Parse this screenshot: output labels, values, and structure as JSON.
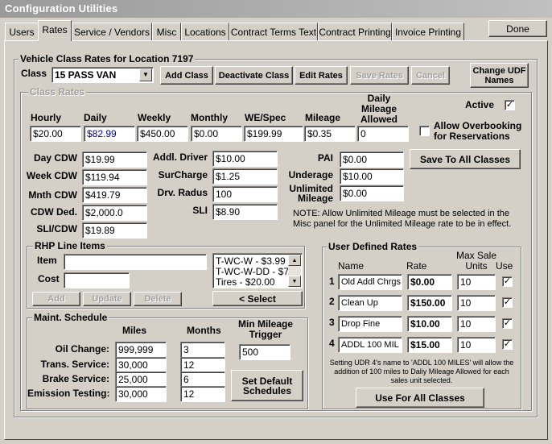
{
  "window": {
    "title": "Configuration Utilities"
  },
  "tabs": [
    "Users",
    "Rates",
    "Service / Vendors",
    "Misc",
    "Locations",
    "Contract Terms Text",
    "Contract Printing",
    "Invoice  Printing"
  ],
  "done_label": "Done",
  "vehicle_group": {
    "title": "Vehicle Class Rates for Location 7197",
    "class_label": "Class",
    "class_value": "15 PASS VAN",
    "buttons": {
      "add_class": "Add Class",
      "deactivate_class": "Deactivate Class",
      "edit_rates": "Edit Rates",
      "save_rates": "Save Rates",
      "cancel": "Cancel",
      "change_udf_names": "Change UDF Names"
    }
  },
  "class_rates": {
    "title": "Class Rates",
    "headers": {
      "hourly": "Hourly",
      "daily": "Daily",
      "weekly": "Weekly",
      "monthly": "Monthly",
      "wespec": "WE/Spec",
      "mileage": "Mileage",
      "daily_mileage_allowed": "Daily Mileage Allowed"
    },
    "values": {
      "hourly": "$20.00",
      "daily": "$82.99",
      "weekly": "$450.00",
      "monthly": "$0.00",
      "wespec": "$199.99",
      "mileage": "$0.35",
      "daily_mileage_allowed": "0"
    },
    "active_label": "Active",
    "active_checked": "✓",
    "overbooking_label": "Allow Overbooking for Reservations",
    "overbooking_checked": "",
    "save_to_all": "Save To All Classes",
    "cdw": {
      "day_cdw": {
        "label": "Day CDW",
        "value": "$19.99"
      },
      "week_cdw": {
        "label": "Week CDW",
        "value": "$119.94"
      },
      "mnth_cdw": {
        "label": "Mnth CDW",
        "value": "$419.79"
      },
      "cdw_ded": {
        "label": "CDW Ded.",
        "value": "$2,000.0"
      },
      "sli_cdw": {
        "label": "SLI/CDW",
        "value": "$19.89"
      }
    },
    "extras": {
      "addl_driver": {
        "label": "Addl. Driver",
        "value": "$10.00"
      },
      "surcharge": {
        "label": "SurCharge",
        "value": "$1.25"
      },
      "drv_radius": {
        "label": "Drv. Radus",
        "value": "100"
      },
      "sli": {
        "label": "SLI",
        "value": "$8.90"
      }
    },
    "misc": {
      "pai": {
        "label": "PAI",
        "value": "$0.00"
      },
      "underage": {
        "label": "Underage",
        "value": "$10.00"
      },
      "unlimited_mileage": {
        "label": "Unlimited Mileage",
        "value": "$0.00"
      }
    },
    "note": "NOTE: Allow Unlimited Mileage must be selected in the Misc panel for the Unlimited Mileage rate to be in effect."
  },
  "rhp": {
    "title": "RHP Line Items",
    "item_label": "Item",
    "cost_label": "Cost",
    "item_value": "",
    "cost_value": "",
    "list": [
      "T-WC-W - $3.99",
      "T-WC-W-DD - $7",
      "Tires - $20.00"
    ],
    "buttons": {
      "add": "Add",
      "update": "Update",
      "delete": "Delete",
      "select": "< Select"
    }
  },
  "maint": {
    "title": "Maint. Schedule",
    "headers": {
      "miles": "Miles",
      "months": "Months",
      "min_trigger": "Min Mileage Trigger"
    },
    "rows": [
      {
        "label": "Oil Change:",
        "miles": "999,999",
        "months": "3"
      },
      {
        "label": "Trans. Service:",
        "miles": "30,000",
        "months": "12"
      },
      {
        "label": "Brake Service:",
        "miles": "25,000",
        "months": "6"
      },
      {
        "label": "Emission Testing:",
        "miles": "30,000",
        "months": "12"
      }
    ],
    "min_trigger_value": "500",
    "set_default": "Set Default Schedules"
  },
  "udr": {
    "title": "User Defined Rates",
    "headers": {
      "name": "Name",
      "rate": "Rate",
      "max_units": "Max Sale Units",
      "use": "Use"
    },
    "rows": [
      {
        "num": "1",
        "name": "Old Addl Chrgs",
        "rate": "$0.00",
        "units": "10",
        "use": "✓"
      },
      {
        "num": "2",
        "name": "Clean Up",
        "rate": "$150.00",
        "units": "10",
        "use": "✓"
      },
      {
        "num": "3",
        "name": "Drop Fine",
        "rate": "$10.00",
        "units": "10",
        "use": "✓"
      },
      {
        "num": "4",
        "name": "ADDL 100 MIL",
        "rate": "$15.00",
        "units": "10",
        "use": "✓"
      }
    ],
    "note": "Setting UDR 4's name to 'ADDL 100 MILES' will allow the addition of 100 miles to Daliy Mileage Allowed for each sales unit selected.",
    "use_all": "Use For All Classes"
  }
}
